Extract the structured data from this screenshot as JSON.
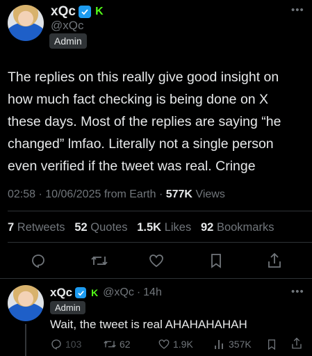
{
  "main_tweet": {
    "author_name": "xQc",
    "author_handle": "@xQc",
    "role_badge": "Admin",
    "text": "The replies on this really give good insight on how much fact checking is being done on X these days. Most of the replies are saying “he changed” lmfao. Literally not a single person even verified if the tweet was real. Cringe",
    "time": "02:58",
    "date": "10/06/2025",
    "source": "from Earth",
    "views_count": "577K",
    "views_label": "Views",
    "retweets_count": "7",
    "retweets_label": "Retweets",
    "quotes_count": "52",
    "quotes_label": "Quotes",
    "likes_count": "1.5K",
    "likes_label": "Likes",
    "bookmarks_count": "92",
    "bookmarks_label": "Bookmarks"
  },
  "reply": {
    "author_name": "xQc",
    "author_handle": "@xQc",
    "time_ago": "14h",
    "role_badge": "Admin",
    "text": "Wait, the tweet is real AHAHAHAHAH",
    "replies": "103",
    "retweets": "62",
    "likes": "1.9K",
    "views": "357K"
  },
  "colors": {
    "background": "#000000",
    "text": "#e7e9ea",
    "muted": "#71767b",
    "verified_blue": "#1d9bf0",
    "kick_green": "#53fc18"
  },
  "icons": [
    "verified-icon",
    "kick-icon",
    "more-icon",
    "reply-icon",
    "retweet-icon",
    "like-icon",
    "bookmark-icon",
    "share-icon",
    "views-icon"
  ]
}
